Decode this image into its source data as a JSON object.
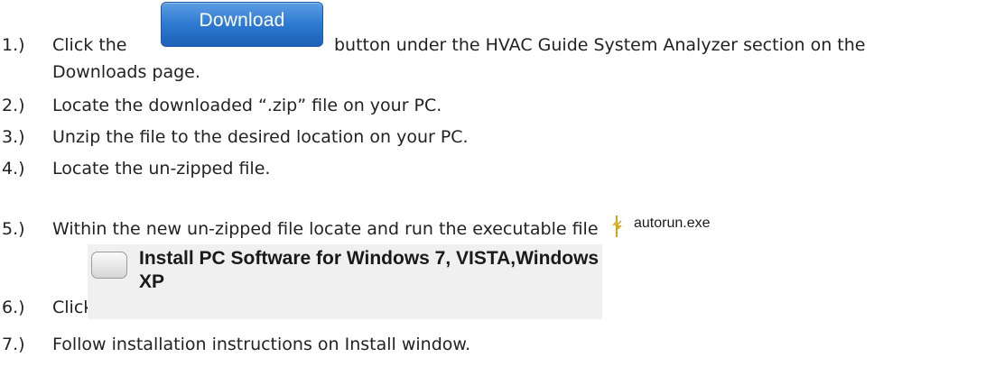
{
  "steps": [
    {
      "num": "1.)",
      "before": "Click the",
      "after": "button under the HVAC Guide System Analyzer section on the",
      "cont": "Downloads page."
    },
    {
      "num": "2.)",
      "text": "Locate the downloaded  “.zip” file on your PC."
    },
    {
      "num": "3.)",
      "text": "Unzip the file to the desired location on your PC."
    },
    {
      "num": "4.)",
      "text": "Locate the un-zipped file."
    },
    {
      "num": "5.)",
      "text": "Within the new un-zipped file locate and run the executable file"
    },
    {
      "num": "6.)",
      "text": "Click on"
    },
    {
      "num": "7.)",
      "text": "Follow installation instructions on Install window."
    }
  ],
  "download_button": {
    "label": "Download"
  },
  "executable": {
    "name": "autorun.exe"
  },
  "install_option": {
    "label": "Install PC Software for Windows 7, VISTA,Windows XP"
  }
}
